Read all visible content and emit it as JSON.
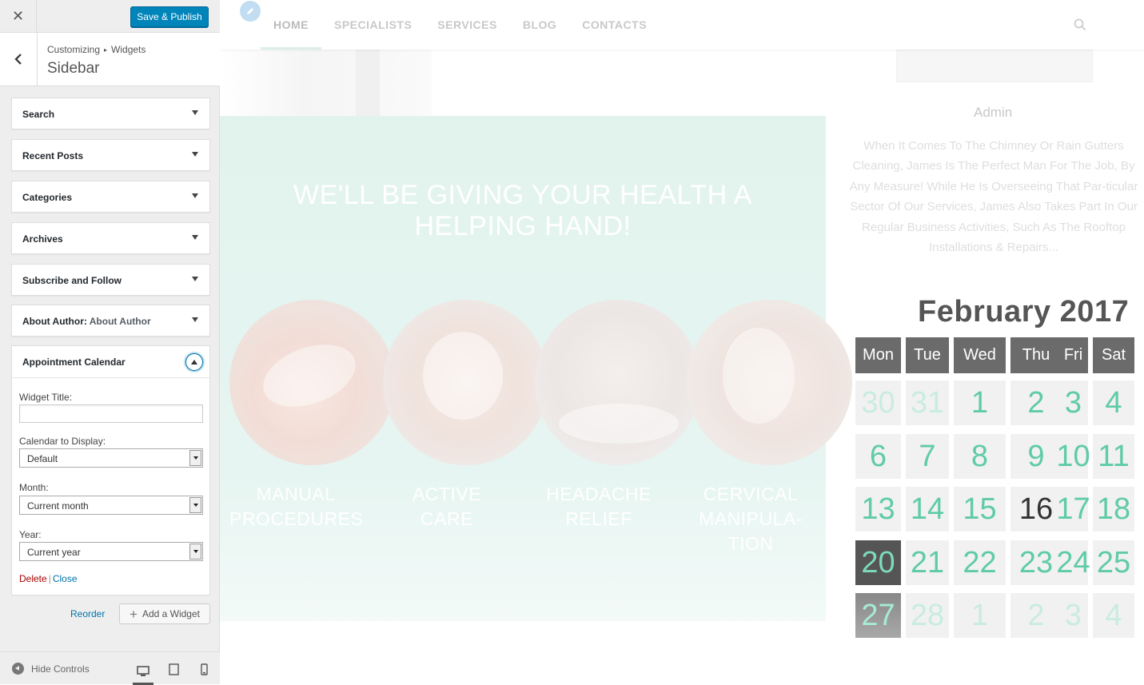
{
  "customizer": {
    "close_icon": "close-icon",
    "save_label": "Save & Publish",
    "breadcrumb": {
      "root": "Customizing",
      "parent": "Widgets"
    },
    "section_title": "Sidebar",
    "widgets": [
      {
        "title": "Search"
      },
      {
        "title": "Recent Posts"
      },
      {
        "title": "Categories"
      },
      {
        "title": "Archives"
      },
      {
        "title": "Subscribe and Follow"
      },
      {
        "title": "About Author:",
        "subtitle": "About Author"
      }
    ],
    "expanded_widget": {
      "title": "Appointment Calendar",
      "fields": {
        "widget_title_label": "Widget Title:",
        "widget_title_value": "",
        "calendar_label": "Calendar to Display:",
        "calendar_value": "Default",
        "month_label": "Month:",
        "month_value": "Current month",
        "year_label": "Year:",
        "year_value": "Current year"
      },
      "delete_label": "Delete",
      "close_label": "Close"
    },
    "reorder_label": "Reorder",
    "add_widget_label": "Add a Widget",
    "hide_controls_label": "Hide Controls"
  },
  "preview": {
    "nav": [
      "HOME",
      "SPECIALISTS",
      "SERVICES",
      "BLOG",
      "CONTACTS"
    ],
    "hero_heading": "WE'LL BE GIVING YOUR HEALTH A HELPING HAND!",
    "services": [
      {
        "line1": "MANUAL",
        "line2": "PROCEDURES",
        "line3": ""
      },
      {
        "line1": "ACTIVE",
        "line2": "CARE",
        "line3": ""
      },
      {
        "line1": "HEADACHE",
        "line2": "RELIEF",
        "line3": ""
      },
      {
        "line1": "CERVICAL",
        "line2": "MANIPULA-",
        "line3": "TION"
      }
    ],
    "author_name": "Admin",
    "author_bio": "When It Comes To The Chimney Or Rain Gutters Cleaning, James Is The Perfect Man For The Job, By Any Measure! While He Is Overseeing That Par-ticular Sector Of Our Services, James Also Takes Part In Our Regular Business Activities, Such As The Rooftop Installations & Repairs...",
    "calendar": {
      "title": "February 2017",
      "weekdays": [
        "Mon",
        "Tue",
        "Wed",
        "Thu",
        "Fri",
        "Sat"
      ],
      "weeks": [
        [
          "30",
          "31",
          "1",
          "2",
          "3",
          "4"
        ],
        [
          "6",
          "7",
          "8",
          "9",
          "10",
          "11"
        ],
        [
          "13",
          "14",
          "15",
          "16",
          "17",
          "18"
        ],
        [
          "20",
          "21",
          "22",
          "23",
          "24",
          "25"
        ],
        [
          "27",
          "28",
          "1",
          "2",
          "3",
          "4"
        ]
      ]
    }
  },
  "colors": {
    "accent": "#0085ba",
    "calendar_number": "#5fcba7",
    "banner": "#e2f3ee"
  }
}
